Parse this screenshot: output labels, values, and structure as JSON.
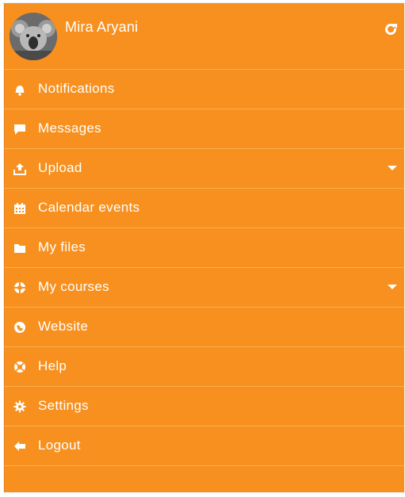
{
  "user": {
    "name": "Mira Aryani",
    "avatar": "koala-photo"
  },
  "header": {
    "refresh_icon": "refresh-icon"
  },
  "menu": {
    "items": [
      {
        "label": "Notifications",
        "icon": "bell-icon"
      },
      {
        "label": "Messages",
        "icon": "chat-icon"
      },
      {
        "label": "Upload",
        "icon": "upload-icon",
        "expandable": true
      },
      {
        "label": "Calendar events",
        "icon": "calendar-icon"
      },
      {
        "label": "My files",
        "icon": "folder-icon"
      },
      {
        "label": "My courses",
        "icon": "courses-icon",
        "expandable": true
      },
      {
        "label": "Website",
        "icon": "globe-icon"
      },
      {
        "label": "Help",
        "icon": "help-icon"
      },
      {
        "label": "Settings",
        "icon": "gear-icon"
      },
      {
        "label": "Logout",
        "icon": "logout-icon"
      }
    ]
  },
  "colors": {
    "background": "#F7901E",
    "divider": "#FBAE4E",
    "text": "#FFFFFF"
  }
}
